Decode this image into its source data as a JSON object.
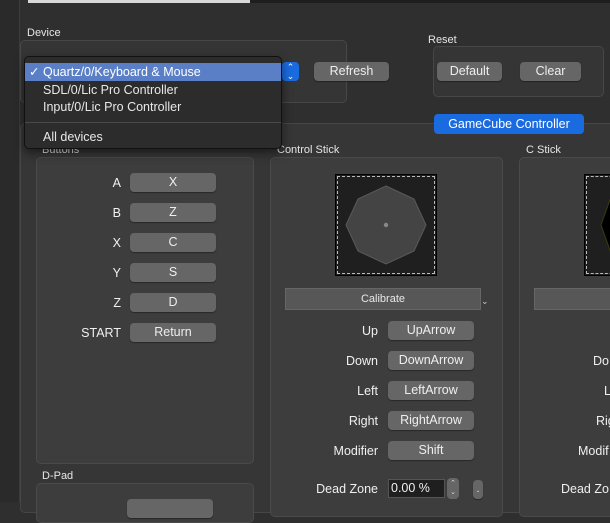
{
  "device": {
    "label": "Device",
    "options": [
      "Quartz/0/Keyboard & Mouse",
      "SDL/0/Lic Pro Controller",
      "Input/0/Lic Pro Controller"
    ],
    "all_devices": "All devices",
    "selected_check": "✓",
    "refresh_label": "Refresh"
  },
  "reset": {
    "label": "Reset",
    "default_label": "Default",
    "clear_label": "Clear"
  },
  "tab": {
    "label": "GameCube Controller"
  },
  "buttons": {
    "label": "Buttons",
    "rows": [
      {
        "name": "A",
        "key": "X"
      },
      {
        "name": "B",
        "key": "Z"
      },
      {
        "name": "X",
        "key": "C"
      },
      {
        "name": "Y",
        "key": "S"
      },
      {
        "name": "Z",
        "key": "D"
      },
      {
        "name": "START",
        "key": "Return"
      }
    ]
  },
  "dpad": {
    "label": "D-Pad"
  },
  "control_stick": {
    "label": "Control Stick",
    "calibrate_label": "Calibrate",
    "rows": [
      {
        "name": "Up",
        "key": "UpArrow"
      },
      {
        "name": "Down",
        "key": "DownArrow"
      },
      {
        "name": "Left",
        "key": "LeftArrow"
      },
      {
        "name": "Right",
        "key": "RightArrow"
      },
      {
        "name": "Modifier",
        "key": "Shift"
      }
    ],
    "dead_zone_label": "Dead Zone",
    "dead_zone_value": "0.00 %",
    "more_label": "."
  },
  "c_stick": {
    "label": "C Stick",
    "rows": [
      "Do",
      "L",
      "Rig",
      "Modif"
    ],
    "dead_zone_label": "Dead Zo"
  }
}
